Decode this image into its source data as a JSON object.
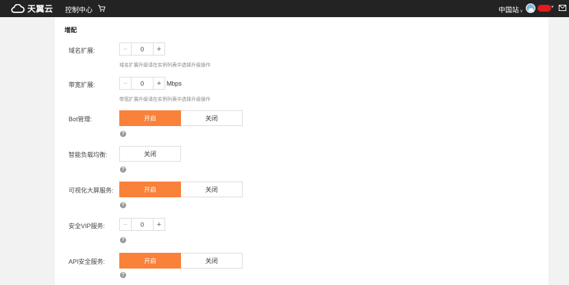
{
  "header": {
    "logo_text": "天翼云",
    "console_label": "控制中心",
    "region_label": "中国站",
    "cart_icon": "cart-icon",
    "mail_icon": "mail-icon"
  },
  "section": {
    "title": "增配"
  },
  "rows": {
    "domain_ext": {
      "label": "域名扩展:",
      "value": "0",
      "minus": "−",
      "plus": "+",
      "hint": "域名扩展升级请在实例列表中选择升级操作"
    },
    "bandwidth_ext": {
      "label": "带宽扩展:",
      "value": "0",
      "minus": "−",
      "plus": "+",
      "unit": "Mbps",
      "hint": "带宽扩展升级请在实例列表中选择升级操作"
    },
    "bot": {
      "label": "Bot管理:",
      "on": "开启",
      "off": "关闭",
      "help": "?"
    },
    "lb": {
      "label": "智能负载均衡:",
      "off": "关闭",
      "help": "?"
    },
    "screen": {
      "label": "可视化大屏服务:",
      "on": "开启",
      "off": "关闭",
      "help": "?"
    },
    "vip": {
      "label": "安全VIP服务:",
      "value": "0",
      "minus": "−",
      "plus": "+",
      "help": "?"
    },
    "api": {
      "label": "API安全服务:",
      "on": "开启",
      "off": "关闭",
      "help": "?"
    }
  },
  "colors": {
    "accent": "#f9813a",
    "topbar": "#232323",
    "background": "#f2f2f2"
  }
}
